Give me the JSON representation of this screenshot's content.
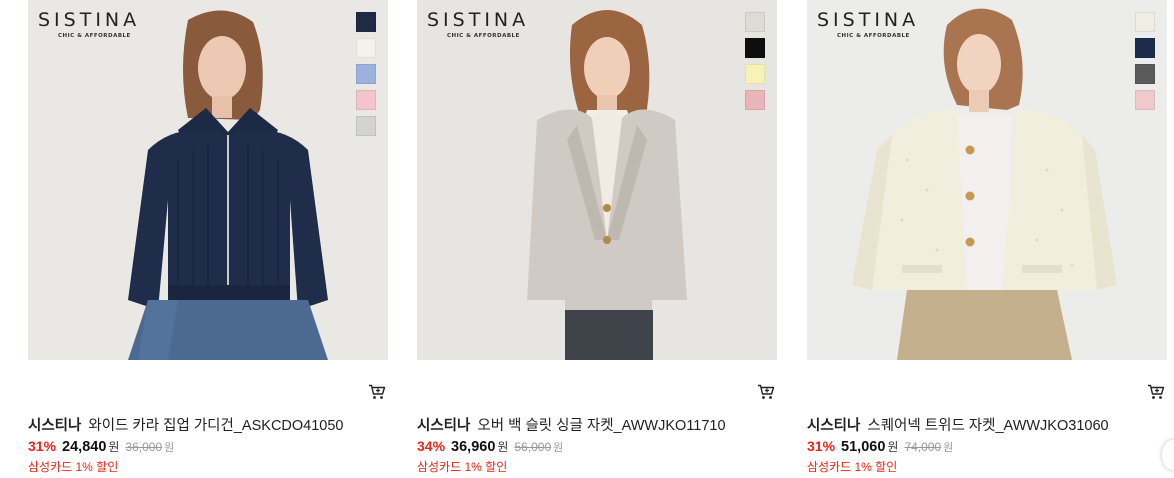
{
  "products": [
    {
      "logo": "SISTINA",
      "logo_sub": "CHIC & AFFORDABLE",
      "swatches": [
        "#1f2a44",
        "#f4f2ea",
        "#9db1de",
        "#f4c4cc",
        "#d3d3d3"
      ],
      "brand": "시스티나",
      "name": "와이드 카라 집업 가디건_ASKCDO41050",
      "discount": "31%",
      "sale_price": "24,840",
      "won": "원",
      "original_price": "36,000",
      "original_won": "원",
      "card_benefit": "삼성카드 1% 할인",
      "cart_icon": "cart-icon"
    },
    {
      "logo": "SISTINA",
      "logo_sub": "CHIC & AFFORDABLE",
      "swatches": [
        "#dedbd6",
        "#0e0e0e",
        "#f7f3b8",
        "#eab5b9"
      ],
      "brand": "시스티나",
      "name": "오버 백 슬릿 싱글 자켓_AWWJKO11710",
      "discount": "34%",
      "sale_price": "36,960",
      "won": "원",
      "original_price": "56,000",
      "original_won": "원",
      "card_benefit": "삼성카드 1% 할인",
      "cart_icon": "cart-icon"
    },
    {
      "logo": "SISTINA",
      "logo_sub": "CHIC & AFFORDABLE",
      "swatches": [
        "#efede4",
        "#1c2c4c",
        "#5a5a5a",
        "#f0c9cc"
      ],
      "brand": "시스티나",
      "name": "스퀘어넥 트위드 자켓_AWWJKO31060",
      "discount": "31%",
      "sale_price": "51,060",
      "won": "원",
      "original_price": "74,000",
      "original_won": "원",
      "card_benefit": "삼성카드 1% 할인",
      "cart_icon": "cart-icon"
    }
  ]
}
